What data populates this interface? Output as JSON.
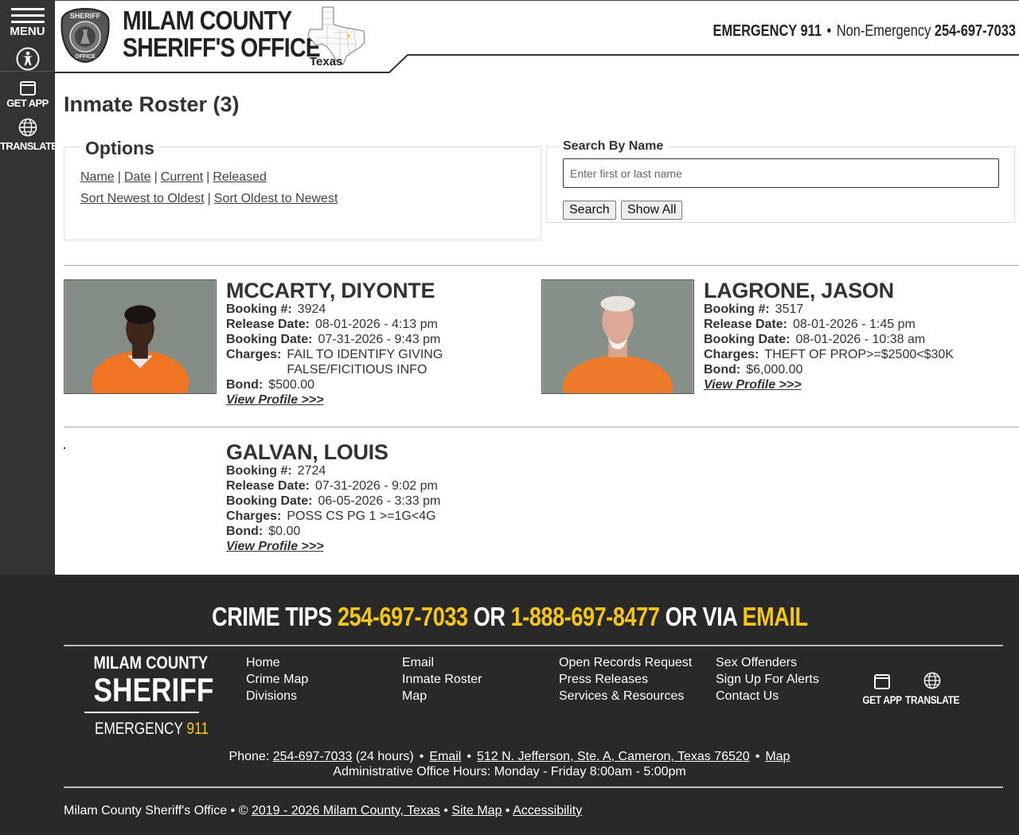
{
  "rail": {
    "menu_label": "MENU",
    "get_app_label": "GET APP",
    "translate_label": "TRANSLATE"
  },
  "header": {
    "title_line1": "MILAM COUNTY",
    "title_line2": "SHERIFF'S OFFICE",
    "state_label": "Texas",
    "emergency_label": "EMERGENCY 911",
    "non_emergency_label": "Non-Emergency",
    "non_emergency_phone": "254-697-7033"
  },
  "page": {
    "title": "Inmate Roster (3)"
  },
  "options": {
    "legend": "Options",
    "filters": [
      "Name",
      "Date",
      "Current",
      "Released"
    ],
    "sorts": [
      "Sort Newest to Oldest",
      "Sort Oldest to Newest"
    ]
  },
  "search": {
    "legend": "Search By Name",
    "placeholder": "Enter first or last name",
    "search_button": "Search",
    "show_all_button": "Show All"
  },
  "labels": {
    "booking": "Booking #:",
    "release_date": "Release Date:",
    "booking_date": "Booking Date:",
    "charges": "Charges:",
    "bond": "Bond:",
    "view_profile": "View Profile >>>"
  },
  "inmates": [
    {
      "name": "MCCARTY, DIYONTE",
      "booking": "3924",
      "release_date": "08-01-2026 - 4:13 pm",
      "booking_date": "07-31-2026 - 9:43 pm",
      "charges": "FAIL TO IDENTIFY GIVING FALSE/FICITIOUS INFO",
      "bond": "$500.00"
    },
    {
      "name": "LAGRONE, JASON",
      "booking": "3517",
      "release_date": "08-01-2026 - 1:45 pm",
      "booking_date": "08-01-2026 - 10:38 am",
      "charges": "THEFT OF PROP>=$2500<$30K",
      "bond": "$6,000.00"
    },
    {
      "name": "GALVAN, LOUIS",
      "booking": "2724",
      "release_date": "07-31-2026 - 9:02 pm",
      "booking_date": "06-05-2026 - 3:33 pm",
      "charges": "POSS CS PG 1 >=1G<4G",
      "bond": "$0.00"
    }
  ],
  "footer": {
    "crime_tips_label": "CRIME TIPS",
    "crime_tips_phone1": "254-697-7033",
    "or1": "OR",
    "crime_tips_phone2": "1-888-697-8477",
    "or_via": "OR VIA",
    "email_word": "EMAIL",
    "logo_line1": "MILAM COUNTY",
    "logo_line2": "SHERIFF",
    "logo_emergency": "EMERGENCY",
    "logo_911": "911",
    "links_col1": [
      "Home",
      "Crime Map",
      "Divisions"
    ],
    "links_col2": [
      "Email",
      "Inmate Roster",
      "Map"
    ],
    "links_col3": [
      "Open Records Request",
      "Press Releases",
      "Services & Resources"
    ],
    "links_col4": [
      "Sex Offenders",
      "Sign Up For Alerts",
      "Contact Us"
    ],
    "get_app_label": "GET APP",
    "translate_label": "TRANSLATE",
    "phone_label": "Phone:",
    "phone": "254-697-7033",
    "phone_note": "(24 hours)",
    "email_link": "Email",
    "address": "512 N. Jefferson, Ste. A, Cameron, Texas 76520",
    "map_link": "Map",
    "hours": "Administrative Office Hours: Monday - Friday 8:00am - 5:00pm",
    "copyright_prefix": "Milam County Sheriff's Office • ©",
    "copyright_link": "2019 - 2026 Milam County, Texas",
    "site_map": "Site Map",
    "accessibility": "Accessibility"
  },
  "colors": {
    "accent_yellow": "#f5c518",
    "rail_bg": "#333333",
    "footer_bg": "#292929"
  }
}
